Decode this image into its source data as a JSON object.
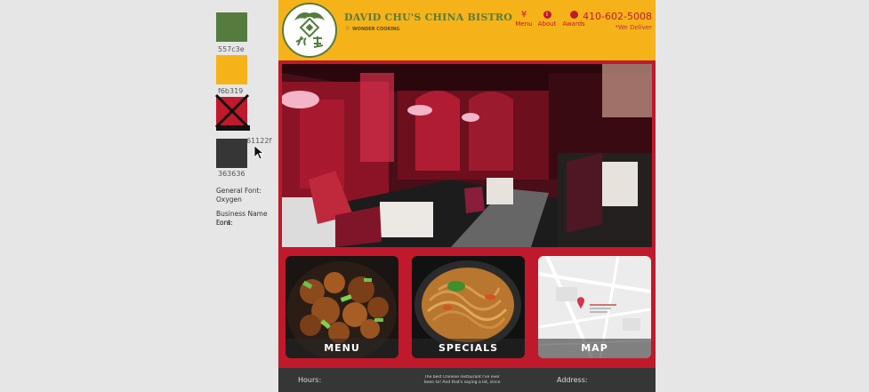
{
  "style_guide": {
    "swatches": [
      {
        "hex": "557c3e",
        "color": "#557c3e"
      },
      {
        "hex": "f6b319",
        "color": "#f6b319"
      },
      {
        "hex": "61122f",
        "color": "#c0192b"
      },
      {
        "hex": "363636",
        "color": "#363636"
      }
    ],
    "general_font_label": "General Font:",
    "general_font_value": "Oxygen",
    "business_font_label": "Business Name Font:",
    "business_font_value": "Lora"
  },
  "site": {
    "business_name": "DAVID CHU'S CHINA BISTRO",
    "tagline": "WONDER COOKING",
    "nav": [
      {
        "label": "Menu",
        "icon": "utensils-icon"
      },
      {
        "label": "About",
        "icon": "info-icon"
      },
      {
        "label": "Awards",
        "icon": "award-icon"
      }
    ],
    "phone": "410-602-5008",
    "deliver": "*We Deliver",
    "tiles": [
      {
        "label": "MENU"
      },
      {
        "label": "SPECIALS"
      },
      {
        "label": "MAP"
      }
    ],
    "footer": {
      "hours_label": "Hours:",
      "quote": "The best Chinese restaurant I've ever been to! And that's saying a lot, since",
      "address_label": "Address:"
    }
  },
  "colors": {
    "green": "#557c3e",
    "gold": "#f6b319",
    "red": "#c0192b",
    "charcoal": "#363636"
  }
}
